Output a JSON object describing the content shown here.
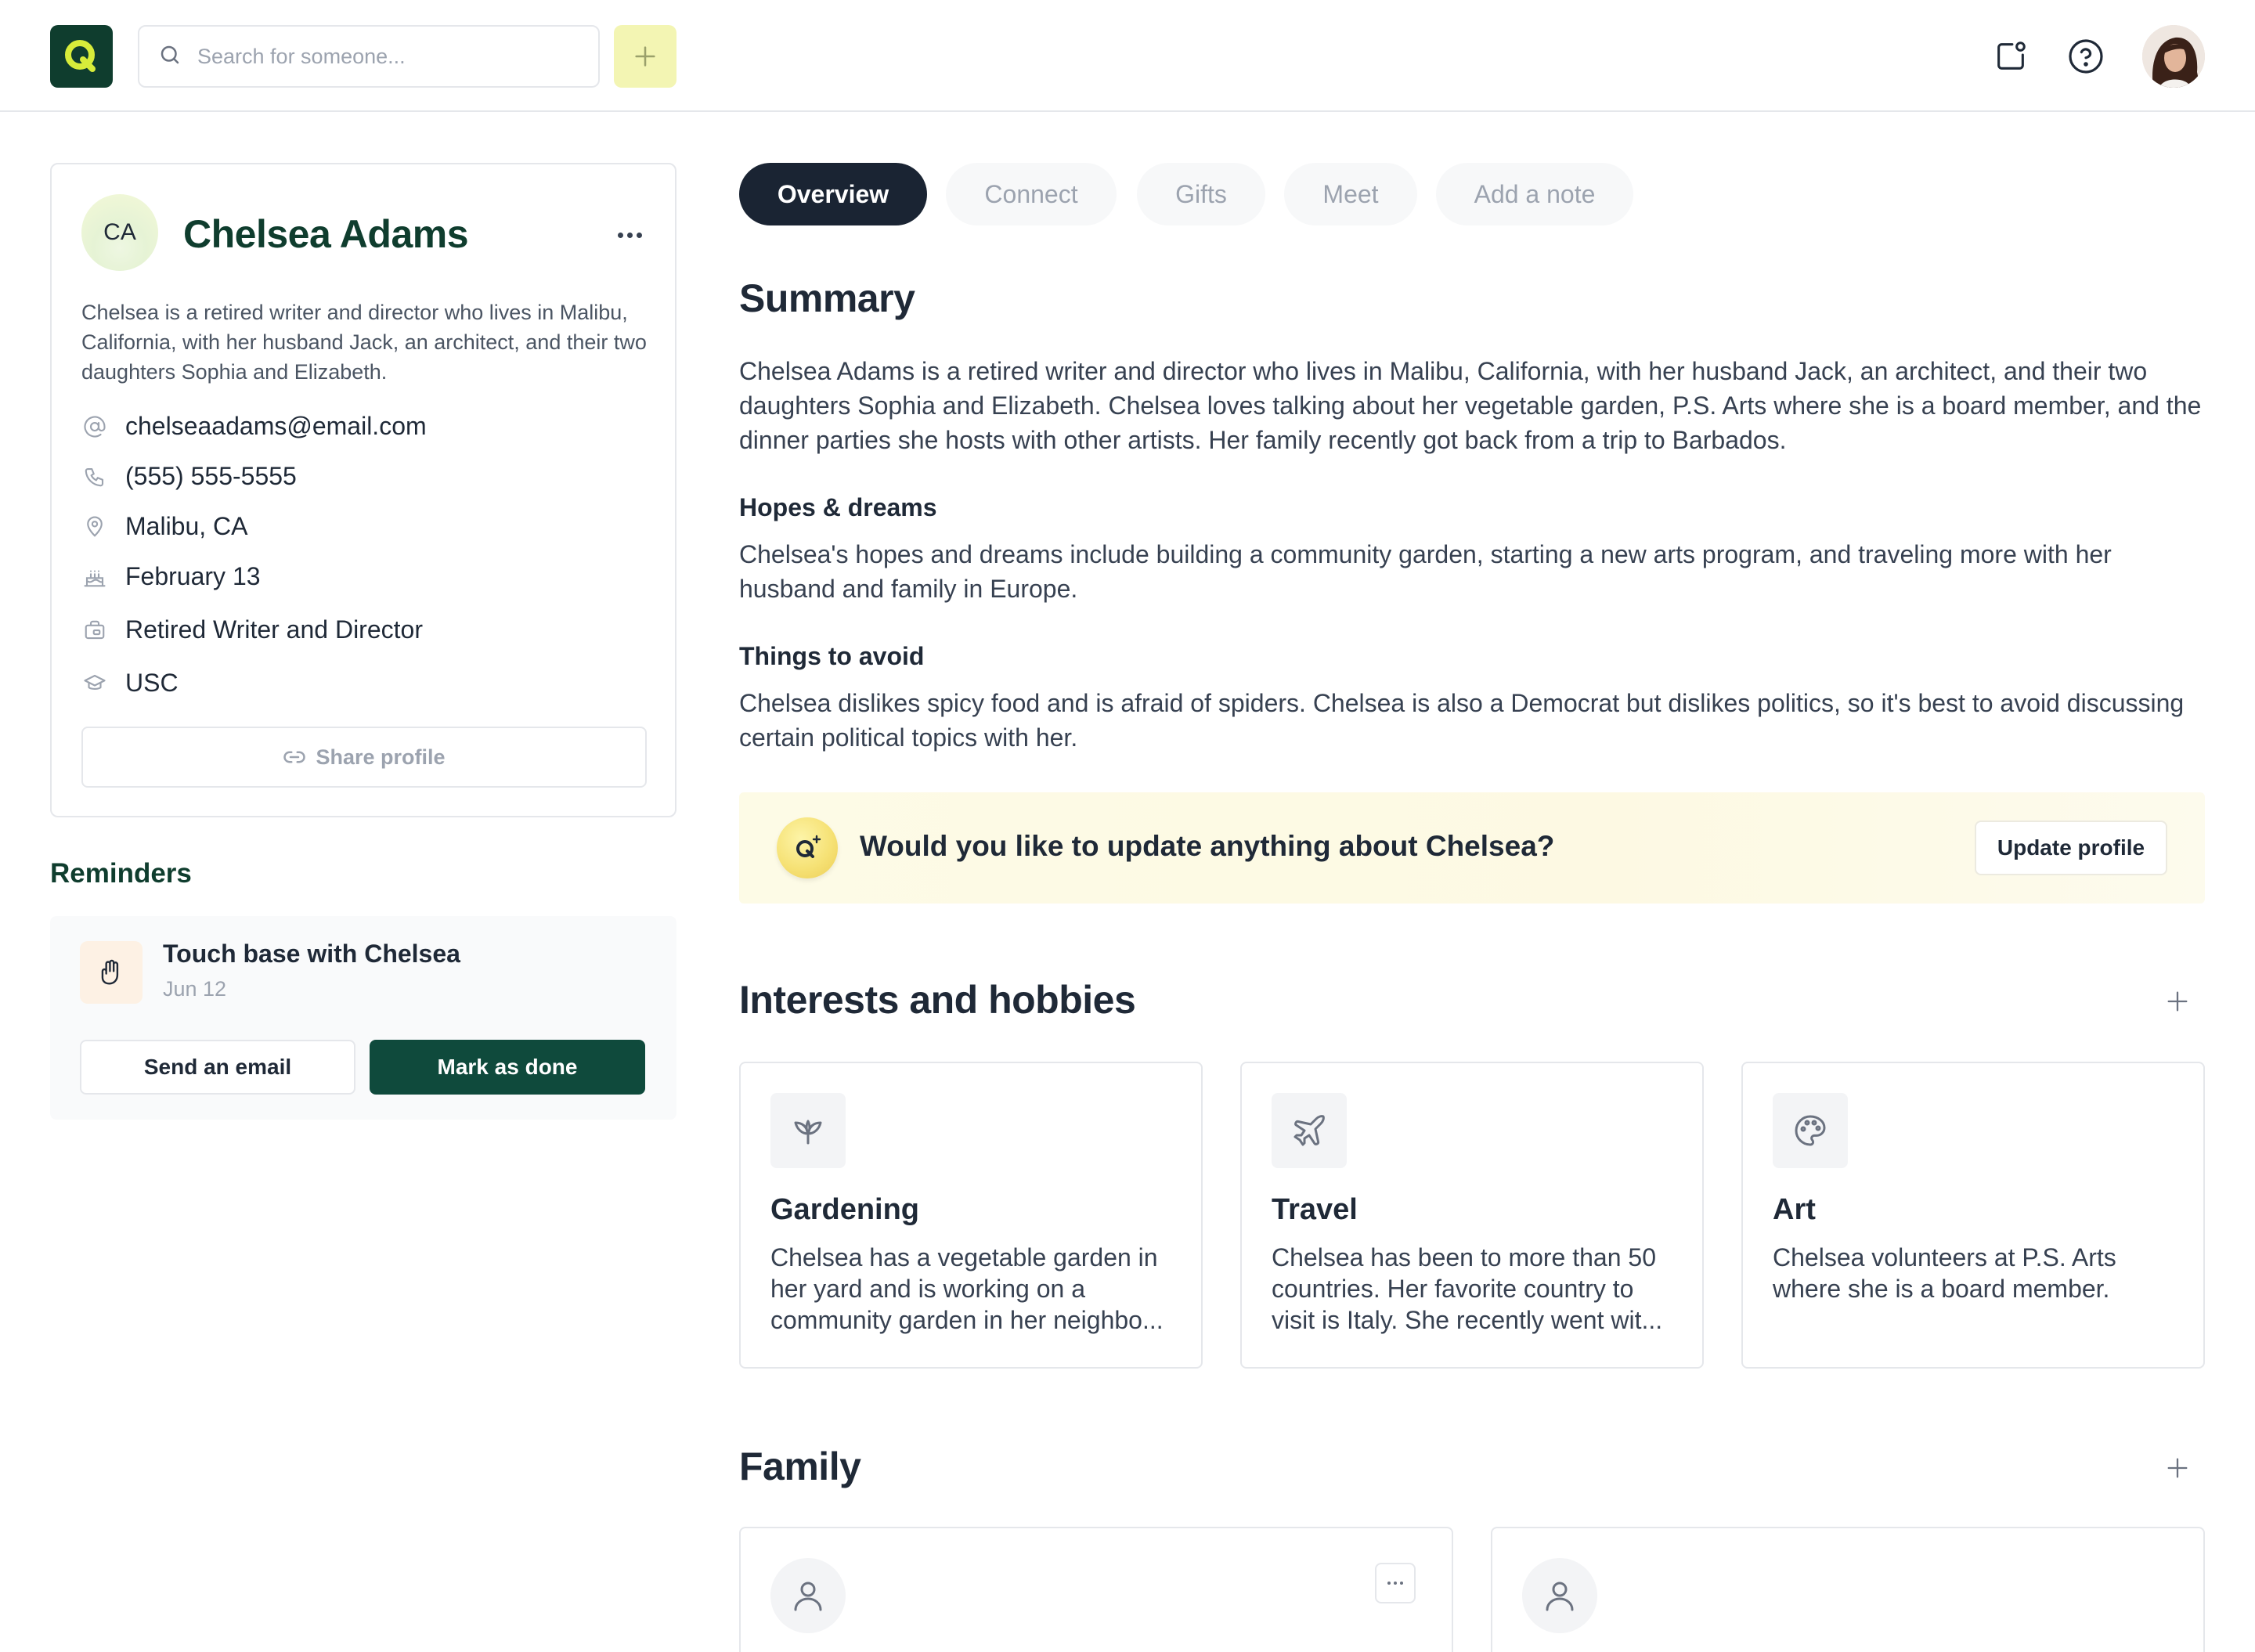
{
  "topbar": {
    "logo_letter": "Q",
    "search_placeholder": "Search for someone...",
    "icons": [
      "notification-icon",
      "help-icon"
    ]
  },
  "profile": {
    "initials": "CA",
    "name": "Chelsea Adams",
    "bio": "Chelsea is a retired writer and director who lives in Malibu, California, with her husband Jack, an architect, and their two daughters Sophia and Elizabeth.",
    "email": "chelseaadams@email.com",
    "phone": "(555) 555-5555",
    "location": "Malibu, CA",
    "birthday": "February 13",
    "occupation": "Retired Writer and Director",
    "education": "USC",
    "share_label": "Share profile"
  },
  "reminders": {
    "title": "Reminders",
    "item": {
      "title": "Touch base with Chelsea",
      "date": "Jun 12",
      "send_label": "Send an email",
      "done_label": "Mark as done"
    }
  },
  "tabs": [
    {
      "label": "Overview",
      "active": true
    },
    {
      "label": "Connect",
      "active": false
    },
    {
      "label": "Gifts",
      "active": false
    },
    {
      "label": "Meet",
      "active": false
    },
    {
      "label": "Add a note",
      "active": false
    }
  ],
  "summary": {
    "title": "Summary",
    "text": "Chelsea Adams is a retired writer and director who lives in Malibu, California, with her husband Jack, an architect, and their two daughters Sophia and Elizabeth. Chelsea loves talking about her vegetable garden, P.S. Arts where she is a board member, and the dinner parties she hosts with other artists. Her family recently got back from a trip to Barbados.",
    "hopes_title": "Hopes & dreams",
    "hopes_text": "Chelsea's hopes and dreams include building a community garden, starting a new arts program, and traveling more with her husband and family in Europe.",
    "avoid_title": "Things to avoid",
    "avoid_text": "Chelsea dislikes spicy food and is afraid of spiders. Chelsea is also a Democrat but dislikes politics, so it's best to avoid discussing certain political topics with her."
  },
  "update_banner": {
    "badge_letter": "Q",
    "text": "Would you like to update anything about Chelsea?",
    "button_label": "Update profile"
  },
  "interests": {
    "title": "Interests and hobbies",
    "items": [
      {
        "title": "Gardening",
        "desc": "Chelsea has a vegetable garden in her yard and is working on a community garden in her neighbo...",
        "icon": "plant-icon"
      },
      {
        "title": "Travel",
        "desc": "Chelsea has been to more than 50 countries. Her favorite country to visit is Italy. She recently went wit...",
        "icon": "plane-icon"
      },
      {
        "title": "Art",
        "desc": "Chelsea volunteers at P.S. Arts where she is a board member.",
        "icon": "palette-icon"
      }
    ]
  },
  "family": {
    "title": "Family"
  },
  "colors": {
    "brand_green": "#0f3d2e",
    "button_green": "#0f4a3c",
    "tab_active": "#1a2433",
    "logo_letter": "#d7ec3a",
    "add_button_bg": "#f3f5b3",
    "banner_bg": "#fdfbe6"
  }
}
